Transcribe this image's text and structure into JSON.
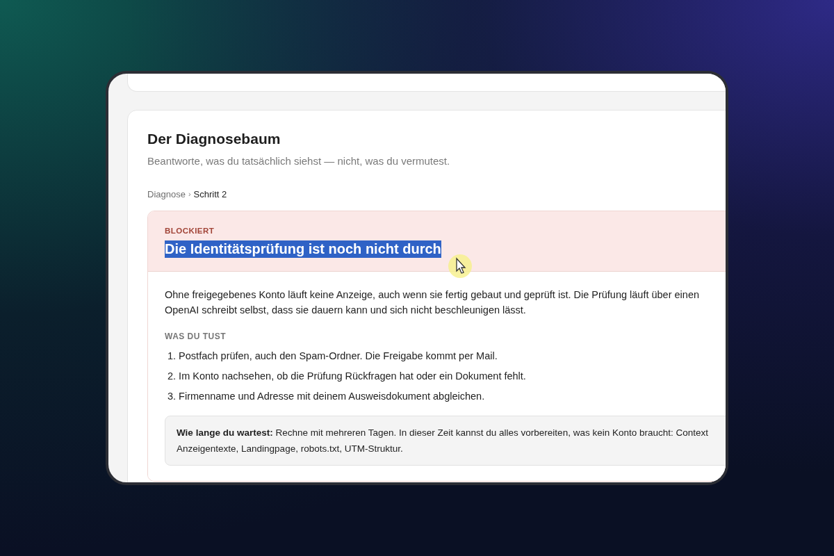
{
  "page": {
    "title": "Der Diagnosebaum",
    "subtitle": "Beantworte, was du tatsächlich siehst — nicht, was du vermutest."
  },
  "breadcrumb": [
    {
      "label": "Diagnose",
      "current": false
    },
    {
      "label": "›",
      "kind": "separator"
    },
    {
      "label": "Schritt 2",
      "current": true
    }
  ],
  "step": {
    "status": "BLOCKIERT",
    "title": "Die Identitätsprüfung ist noch nicht durch",
    "title_highlighted": true,
    "description_lines": [
      "Ohne freigegebenes Konto läuft keine Anzeige, auch wenn sie fertig gebaut und geprüft ist. Die Prüfung läuft über einen",
      "OpenAI schreibt selbst, dass sie dauern kann und sich nicht beschleunigen lässt."
    ],
    "actions_heading": "WAS DU TUST",
    "actions": [
      "1. Postfach prüfen, auch den Spam-Ordner. Die Freigabe kommt per Mail.",
      "2. Im Konto nachsehen, ob die Prüfung Rückfragen hat oder ein Dokument fehlt.",
      "3. Firmenname und Adresse mit deinem Ausweisdokument abgleichen."
    ],
    "note_lines": [
      "**Wie lange du wartest:** Rechne mit mehreren Tagen. In dieser Zeit kannst du alles vorbereiten, was kein Konto braucht: Context",
      "Anzeigentexte, Landingpage, robots.txt, UTM-Struktur."
    ]
  }
}
